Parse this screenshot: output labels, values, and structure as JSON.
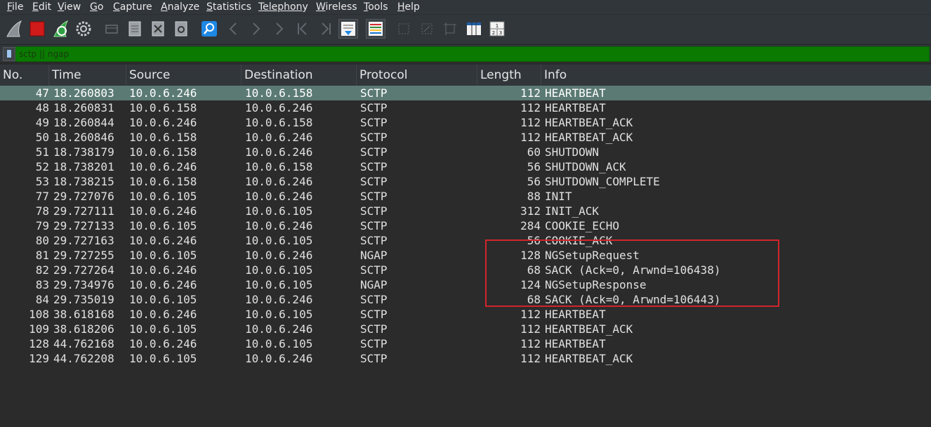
{
  "menu": [
    {
      "first": "F",
      "rest": "ile"
    },
    {
      "first": "E",
      "rest": "dit"
    },
    {
      "first": "V",
      "rest": "iew"
    },
    {
      "first": "G",
      "rest": "o"
    },
    {
      "first": "C",
      "rest": "apture"
    },
    {
      "first": "A",
      "rest": "nalyze"
    },
    {
      "first": "S",
      "rest": "tatistics"
    },
    {
      "first": "Telephon",
      "rest": "y"
    },
    {
      "first": "W",
      "rest": "ireless"
    },
    {
      "first": "T",
      "rest": "ools"
    },
    {
      "first": "H",
      "rest": "elp"
    }
  ],
  "toolbar": {
    "icons": [
      "shark-fin-icon",
      "stop-capture-icon",
      "restart-capture-icon",
      "capture-options-icon",
      "open-file-icon",
      "save-file-icon",
      "close-file-icon",
      "reload-file-icon",
      "find-packet-icon",
      "go-back-icon",
      "go-forward-icon",
      "go-to-packet-icon",
      "first-packet-icon",
      "last-packet-icon",
      "auto-scroll-icon",
      "colorize-icon",
      "zoom-in-icon",
      "zoom-out-icon",
      "normal-size-icon",
      "resize-columns-icon",
      "column-layout-icon"
    ],
    "column_layout_label": "1 2 3"
  },
  "filter": {
    "value": "sctp || ngap",
    "color": "#0a7a00"
  },
  "columns": [
    "No.",
    "Time",
    "Source",
    "Destination",
    "Protocol",
    "Length",
    "Info"
  ],
  "packets": [
    {
      "no": "47",
      "time": "18.260803",
      "src": "10.0.6.246",
      "dst": "10.0.6.158",
      "proto": "SCTP",
      "len": "112",
      "info": "HEARTBEAT",
      "selected": true
    },
    {
      "no": "48",
      "time": "18.260831",
      "src": "10.0.6.158",
      "dst": "10.0.6.246",
      "proto": "SCTP",
      "len": "112",
      "info": "HEARTBEAT"
    },
    {
      "no": "49",
      "time": "18.260844",
      "src": "10.0.6.246",
      "dst": "10.0.6.158",
      "proto": "SCTP",
      "len": "112",
      "info": "HEARTBEAT_ACK"
    },
    {
      "no": "50",
      "time": "18.260846",
      "src": "10.0.6.158",
      "dst": "10.0.6.246",
      "proto": "SCTP",
      "len": "112",
      "info": "HEARTBEAT_ACK"
    },
    {
      "no": "51",
      "time": "18.738179",
      "src": "10.0.6.158",
      "dst": "10.0.6.246",
      "proto": "SCTP",
      "len": "60",
      "info": "SHUTDOWN"
    },
    {
      "no": "52",
      "time": "18.738201",
      "src": "10.0.6.246",
      "dst": "10.0.6.158",
      "proto": "SCTP",
      "len": "56",
      "info": "SHUTDOWN_ACK"
    },
    {
      "no": "53",
      "time": "18.738215",
      "src": "10.0.6.158",
      "dst": "10.0.6.246",
      "proto": "SCTP",
      "len": "56",
      "info": "SHUTDOWN_COMPLETE"
    },
    {
      "no": "77",
      "time": "29.727076",
      "src": "10.0.6.105",
      "dst": "10.0.6.246",
      "proto": "SCTP",
      "len": "88",
      "info": "INIT"
    },
    {
      "no": "78",
      "time": "29.727111",
      "src": "10.0.6.246",
      "dst": "10.0.6.105",
      "proto": "SCTP",
      "len": "312",
      "info": "INIT_ACK"
    },
    {
      "no": "79",
      "time": "29.727133",
      "src": "10.0.6.105",
      "dst": "10.0.6.246",
      "proto": "SCTP",
      "len": "284",
      "info": "COOKIE_ECHO"
    },
    {
      "no": "80",
      "time": "29.727163",
      "src": "10.0.6.246",
      "dst": "10.0.6.105",
      "proto": "SCTP",
      "len": "56",
      "info": "COOKIE_ACK"
    },
    {
      "no": "81",
      "time": "29.727255",
      "src": "10.0.6.105",
      "dst": "10.0.6.246",
      "proto": "NGAP",
      "len": "128",
      "info": "NGSetupRequest"
    },
    {
      "no": "82",
      "time": "29.727264",
      "src": "10.0.6.246",
      "dst": "10.0.6.105",
      "proto": "SCTP",
      "len": "68",
      "info": "SACK (Ack=0, Arwnd=106438)"
    },
    {
      "no": "83",
      "time": "29.734976",
      "src": "10.0.6.246",
      "dst": "10.0.6.105",
      "proto": "NGAP",
      "len": "124",
      "info": "NGSetupResponse"
    },
    {
      "no": "84",
      "time": "29.735019",
      "src": "10.0.6.105",
      "dst": "10.0.6.246",
      "proto": "SCTP",
      "len": "68",
      "info": "SACK (Ack=0, Arwnd=106443)"
    },
    {
      "no": "108",
      "time": "38.618168",
      "src": "10.0.6.246",
      "dst": "10.0.6.105",
      "proto": "SCTP",
      "len": "112",
      "info": "HEARTBEAT"
    },
    {
      "no": "109",
      "time": "38.618206",
      "src": "10.0.6.105",
      "dst": "10.0.6.246",
      "proto": "SCTP",
      "len": "112",
      "info": "HEARTBEAT_ACK"
    },
    {
      "no": "128",
      "time": "44.762168",
      "src": "10.0.6.246",
      "dst": "10.0.6.105",
      "proto": "SCTP",
      "len": "112",
      "info": "HEARTBEAT"
    },
    {
      "no": "129",
      "time": "44.762208",
      "src": "10.0.6.105",
      "dst": "10.0.6.246",
      "proto": "SCTP",
      "len": "112",
      "info": "HEARTBEAT_ACK"
    }
  ],
  "colors": {
    "selected_row": "#5b7a74",
    "annotation_box": "#d0252b"
  }
}
